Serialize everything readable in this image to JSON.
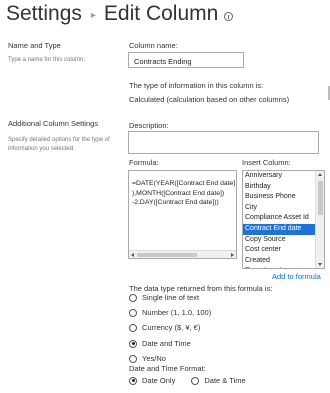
{
  "header": {
    "breadcrumb_root": "Settings",
    "page_title": "Edit Column"
  },
  "name_type": {
    "heading": "Name and Type",
    "description": "Type a name for this column.",
    "column_name_label": "Column name:",
    "column_name_value": "Contracts Ending",
    "type_info_label": "The type of information in this column is:",
    "type_value": "Calculated (calculation based on other columns)"
  },
  "additional": {
    "heading": "Additional Column Settings",
    "description": "Specify detailed options for the type of information you selected.",
    "description_label": "Description:",
    "formula_label": "Formula:",
    "formula_value": "=DATE(YEAR([Contract End date]\n),MONTH([Contract End date])\n-2,DAY([Contract End date]))",
    "insert_column_label": "Insert Column:",
    "insert_columns": [
      "Anniversary",
      "Birthday",
      "Business Phone",
      "City",
      "Compliance Asset Id",
      "Contract End date",
      "Copy Source",
      "Cost center",
      "Created",
      "Department"
    ],
    "insert_columns_selected": "Contract End date",
    "add_to_formula": "Add to formula"
  },
  "return_type": {
    "label": "The data type returned from this formula is:",
    "options": [
      {
        "label": "Single line of text",
        "checked": false
      },
      {
        "label": "Number (1, 1.0, 100)",
        "checked": false
      },
      {
        "label": "Currency ($, ¥, €)",
        "checked": false
      },
      {
        "label": "Date and Time",
        "checked": true
      },
      {
        "label": "Yes/No",
        "checked": false
      }
    ]
  },
  "date_format": {
    "label": "Date and Time Format:",
    "options": [
      {
        "label": "Date Only",
        "checked": true
      },
      {
        "label": "Date & Time",
        "checked": false
      }
    ]
  }
}
